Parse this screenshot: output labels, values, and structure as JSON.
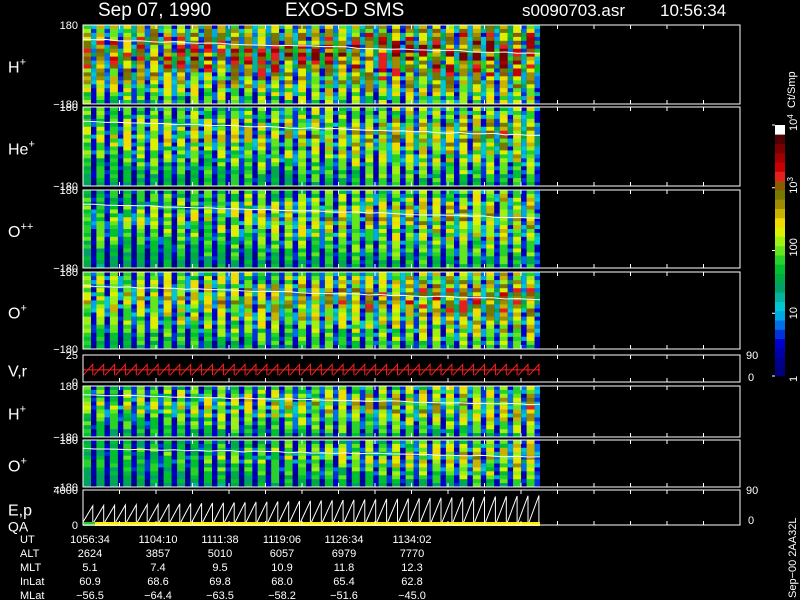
{
  "header": {
    "date": "Sep 07, 1990",
    "instrument": "EXOS-D SMS",
    "file": "s0090703.asr",
    "time": "10:56:34"
  },
  "colorbar": {
    "unit": "Ct/Smp",
    "ticks": [
      {
        "label": "1",
        "value": 1
      },
      {
        "label": "10",
        "value": 10
      },
      {
        "label": "100",
        "value": 100
      },
      {
        "label": "10",
        "sup": "3",
        "value": 1000
      },
      {
        "label": "10",
        "sup": "4",
        "value": 10000
      }
    ],
    "colors": [
      "#00007a",
      "#00008f",
      "#0000aa",
      "#0000cc",
      "#0032dc",
      "#0070e8",
      "#00a8e6",
      "#00c8d2",
      "#00b4a0",
      "#00a068",
      "#00aa46",
      "#00c032",
      "#28d228",
      "#64e61e",
      "#a0f014",
      "#dcf000",
      "#f0dc00",
      "#c8b400",
      "#a08c00",
      "#787800",
      "#8c5a00",
      "#e61e1e",
      "#c80000",
      "#a00000",
      "#780000",
      "#500000",
      "#ffffff"
    ]
  },
  "panels": [
    {
      "label": "H",
      "sup": "+",
      "type": "spectrogram",
      "ymax": "180",
      "ymin": "−180",
      "intensity": 0.72,
      "trend": 0.35
    },
    {
      "label": "He",
      "sup": "+",
      "type": "spectrogram",
      "ymax": "180",
      "ymin": "−180",
      "intensity": 0.45,
      "trend": 0.4
    },
    {
      "label": "O",
      "sup": "++",
      "type": "spectrogram",
      "ymax": "180",
      "ymin": "−180",
      "intensity": 0.4,
      "trend": 0.45
    },
    {
      "label": "O",
      "sup": "+",
      "type": "spectrogram",
      "ymax": "180",
      "ymin": "−180",
      "intensity": 0.5,
      "trend": 0.5
    },
    {
      "label": "V,r",
      "sup": "",
      "type": "sawtooth",
      "ymax": "25",
      "ymin": "0",
      "right_max": "90",
      "right_min": "0"
    },
    {
      "label": "H",
      "sup": "+",
      "type": "spectrogram",
      "ymax": "180",
      "ymin": "−180",
      "intensity": 0.45,
      "trend": 0.4
    },
    {
      "label": "O",
      "sup": "+",
      "type": "spectrogram",
      "ymax": "180",
      "ymin": "−180",
      "intensity": 0.3,
      "trend": 0.6
    },
    {
      "label": "E,p",
      "label2": "QA",
      "sup": "",
      "type": "sawtooth",
      "ymax": "4000",
      "ymin": "0",
      "right_max": "90",
      "right_min": "0"
    }
  ],
  "table": {
    "rows": [
      {
        "name": "UT",
        "values": [
          "1056:34",
          "1104:10",
          "1111:38",
          "1119:06",
          "1126:34",
          "1134:02"
        ]
      },
      {
        "name": "ALT",
        "values": [
          "2624",
          "3857",
          "5010",
          "6057",
          "6979",
          "7770"
        ]
      },
      {
        "name": "MLT",
        "values": [
          "5.1",
          "7.4",
          "9.5",
          "10.9",
          "11.8",
          "12.3"
        ]
      },
      {
        "name": "InLat",
        "values": [
          "60.9",
          "68.6",
          "69.8",
          "68.0",
          "65.4",
          "62.8"
        ]
      },
      {
        "name": "MLat",
        "values": [
          "−56.5",
          "−64.4",
          "−63.5",
          "−58.2",
          "−51.6",
          "−45.0"
        ]
      }
    ]
  },
  "footer_id": "Sep−00 2AA32L",
  "chart_data": {
    "type": "heatmap",
    "title": "Sep 07, 1990   EXOS-D SMS",
    "x": [
      "1056:34",
      "1104:10",
      "1111:38",
      "1119:06",
      "1126:34",
      "1134:02"
    ],
    "series": [
      {
        "name": "H+",
        "ylim": [
          -180,
          180
        ]
      },
      {
        "name": "He+",
        "ylim": [
          -180,
          180
        ]
      },
      {
        "name": "O++",
        "ylim": [
          -180,
          180
        ]
      },
      {
        "name": "O+",
        "ylim": [
          -180,
          180
        ]
      },
      {
        "name": "V,r",
        "ylim": [
          0,
          25
        ]
      },
      {
        "name": "H+",
        "ylim": [
          -180,
          180
        ]
      },
      {
        "name": "O+",
        "ylim": [
          -180,
          180
        ]
      },
      {
        "name": "E,p",
        "ylim": [
          0,
          4000
        ]
      }
    ],
    "colorscale": {
      "unit": "Ct/Smp",
      "range": [
        1,
        10000
      ],
      "scale": "log"
    }
  }
}
